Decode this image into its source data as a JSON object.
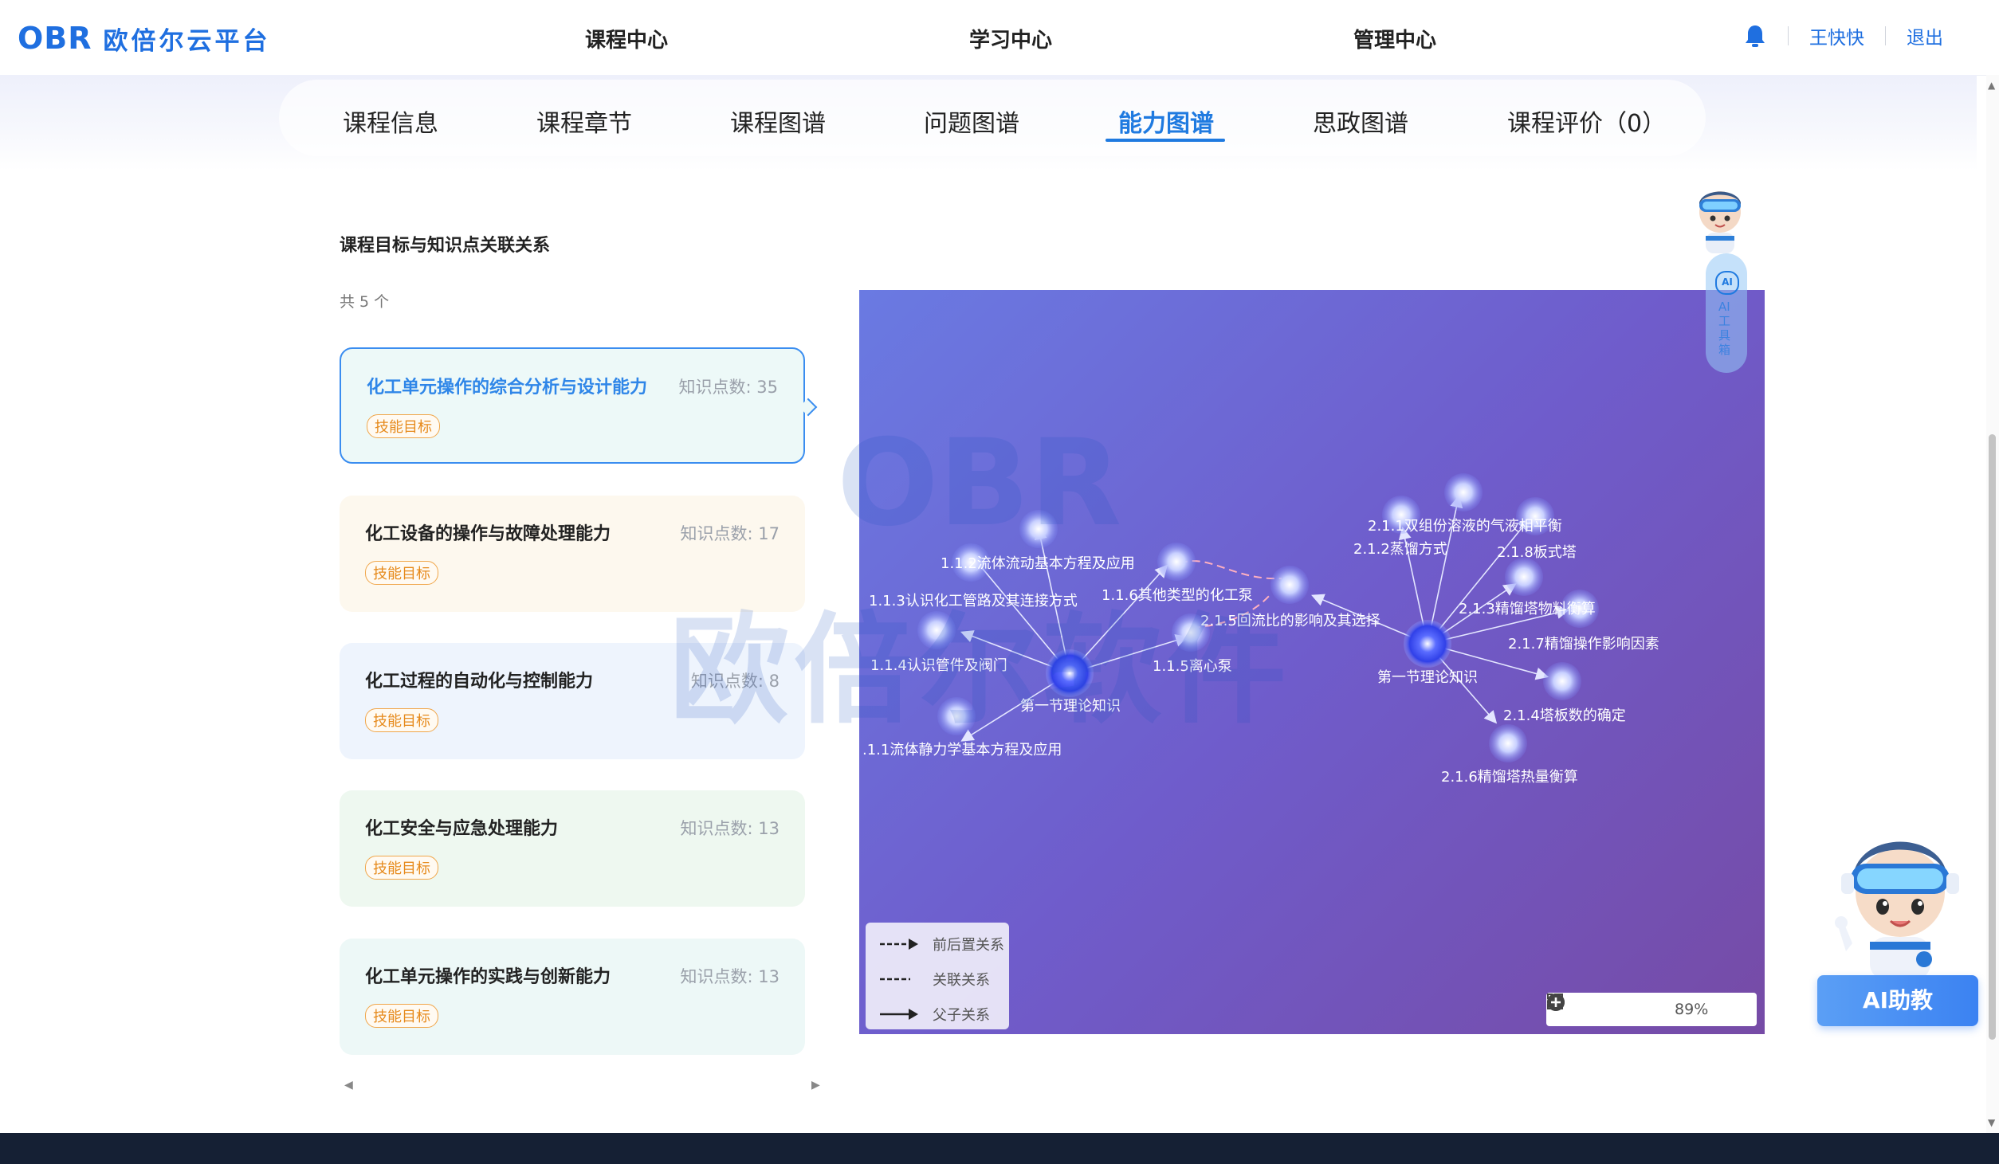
{
  "header": {
    "logo_mark": "OBR",
    "logo_text": "欧倍尔云平台",
    "nav": [
      "课程中心",
      "学习中心",
      "管理中心"
    ],
    "user": "王快快",
    "logout": "退出"
  },
  "tabs": [
    "课程信息",
    "课程章节",
    "课程图谱",
    "问题图谱",
    "能力图谱",
    "思政图谱",
    "课程评价（0）"
  ],
  "active_tab": "能力图谱",
  "content": {
    "section_title": "课程目标与知识点关联关系",
    "count_text": "共 5 个",
    "cards": [
      {
        "title": "化工单元操作的综合分析与设计能力",
        "count": "知识点数: 35",
        "badge": "技能目标",
        "bg": "#edf9f8"
      },
      {
        "title": "化工设备的操作与故障处理能力",
        "count": "知识点数: 17",
        "badge": "技能目标",
        "bg": "#fdf8ee"
      },
      {
        "title": "化工过程的自动化与控制能力",
        "count": "知识点数: 8",
        "badge": "技能目标",
        "bg": "#eef4fd"
      },
      {
        "title": "化工安全与应急处理能力",
        "count": "知识点数: 13",
        "badge": "技能目标",
        "bg": "#eef8f0"
      },
      {
        "title": "化工单元操作的实践与创新能力",
        "count": "知识点数: 13",
        "badge": "技能目标",
        "bg": "#edf8f7"
      }
    ]
  },
  "graph": {
    "nodes": [
      {
        "label": "第一节理论知识"
      },
      {
        "label": "1.1.2流体流动基本方程及应用"
      },
      {
        "label": "1.1.3认识化工管路及其连接方式"
      },
      {
        "label": "1.1.4认识管件及阀门"
      },
      {
        "label": ".1.1流体静力学基本方程及应用"
      },
      {
        "label": "1.1.6其他类型的化工泵"
      },
      {
        "label": "1.1.5离心泵"
      },
      {
        "label": "2.1.5回流比的影响及其选择"
      },
      {
        "label": "第一节理论知识"
      },
      {
        "label": "2.1.1双组份溶液的气液相平衡"
      },
      {
        "label": "2.1.2蒸馏方式"
      },
      {
        "label": "2.1.8板式塔"
      },
      {
        "label": "2.1.3精馏塔物料衡算"
      },
      {
        "label": "2.1.7精馏操作影响因素"
      },
      {
        "label": "2.1.4塔板数的确定"
      },
      {
        "label": "2.1.6精馏塔热量衡算"
      }
    ],
    "legend": [
      "前后置关系",
      "关联关系",
      "父子关系"
    ],
    "zoom": "89%"
  },
  "assistant": {
    "button": "AI助教",
    "icon_text": "AI",
    "side_label": "AI工具箱"
  },
  "watermark": {
    "logo": "OBR",
    "text": "欧倍尔软件"
  }
}
